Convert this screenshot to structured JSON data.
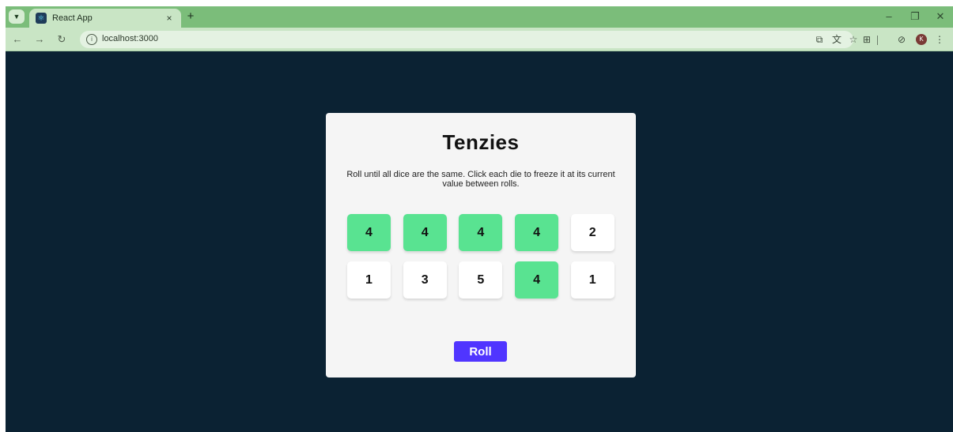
{
  "browser": {
    "tab_title": "React App",
    "tab_close": "×",
    "new_tab": "+",
    "url": "localhost:3000",
    "window_controls": [
      "–",
      "❐",
      "✕"
    ],
    "profile_initial": "K",
    "icons": {
      "tab_search": "chevron-down-icon",
      "back": "arrow-left-icon",
      "forward": "arrow-right-icon",
      "reload": "reload-icon",
      "site_info": "site-info-icon",
      "cast": "cast-icon",
      "translate": "translate-icon",
      "bookmark": "star-icon",
      "extensions": "puzzle-icon",
      "chrome_labs": "flask-icon",
      "menu": "kebab-menu-icon"
    }
  },
  "game": {
    "title": "Tenzies",
    "instructions": "Roll until all dice are the same. Click each die to freeze it at its current value between rolls.",
    "dice": [
      {
        "value": "4",
        "held": true
      },
      {
        "value": "4",
        "held": true
      },
      {
        "value": "4",
        "held": true
      },
      {
        "value": "4",
        "held": true
      },
      {
        "value": "2",
        "held": false
      },
      {
        "value": "1",
        "held": false
      },
      {
        "value": "3",
        "held": false
      },
      {
        "value": "5",
        "held": false
      },
      {
        "value": "4",
        "held": true
      },
      {
        "value": "1",
        "held": false
      }
    ],
    "roll_label": "Roll"
  },
  "colors": {
    "page_bg": "#0b2233",
    "card_bg": "#f5f5f5",
    "held_die": "#59e391",
    "free_die": "#ffffff",
    "roll_button": "#5035ff",
    "tab_strip": "#7bbd7a"
  }
}
